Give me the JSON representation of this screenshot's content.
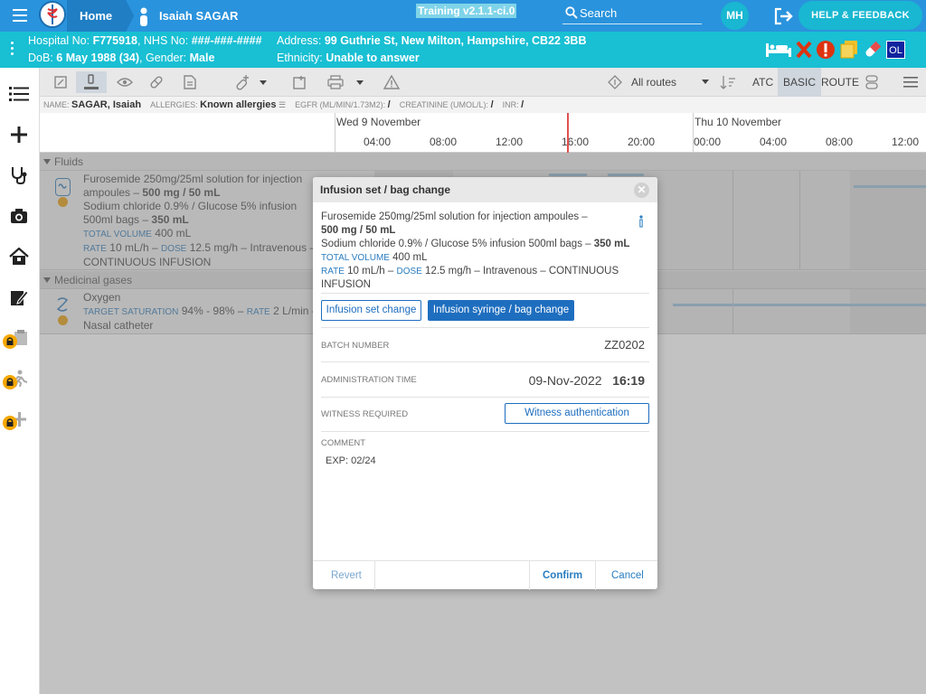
{
  "topbar": {
    "home_label": "Home",
    "patient_name": "Isaiah SAGAR",
    "training_badge": "Training v2.1.1-ci.0",
    "search_placeholder": "Search",
    "avatar_initials": "MH",
    "help_label": "HELP & FEEDBACK"
  },
  "banner": {
    "hospital_label": "Hospital No:",
    "hospital_no": "F775918",
    "nhs_label": "NHS No:",
    "nhs_no": "###-###-####",
    "dob_label": "DoB:",
    "dob": "6 May 1988 (34)",
    "gender_label": "Gender:",
    "gender": "Male",
    "address_label": "Address:",
    "address": "99 Guthrie St, New Milton, Hampshire, CB22 3BB",
    "ethnicity_label": "Ethnicity:",
    "ethnicity": "Unable to answer",
    "ol_badge": "OL"
  },
  "toolbar": {
    "routes_label": "All routes",
    "atc_label": "ATC",
    "basic_label": "BASIC",
    "route_label": "ROUTE"
  },
  "info": {
    "name_label": "NAME:",
    "name": "SAGAR, Isaiah",
    "allergies_label": "ALLERGIES:",
    "allergies": "Known allergies",
    "egfr_label": "EGFR (ML/MIN/1.73M2):",
    "egfr": "/",
    "creatinine_label": "CREATININE (UMOL/L):",
    "creatinine": "/",
    "inr_label": "INR:",
    "inr": "/"
  },
  "timeline": {
    "day1": "Wed 9 November",
    "day2": "Thu 10 November",
    "hours": [
      "04:00",
      "08:00",
      "12:00",
      "16:00",
      "20:00",
      "00:00",
      "04:00",
      "08:00",
      "12:00"
    ]
  },
  "sections": {
    "fluids": "Fluids",
    "gases": "Medicinal gases"
  },
  "fluids_row": {
    "line1": "Furosemide 250mg/25ml solution for injection",
    "line2a": "ampoules – ",
    "line2b": "500 mg / 50 mL",
    "line3": "Sodium chloride 0.9% / Glucose 5% infusion",
    "line4a": "500ml bags – ",
    "line4b": "350 mL",
    "total_label": "TOTAL VOLUME",
    "total_value": "400 mL",
    "rate_label": "RATE",
    "rate_value": "10 mL/h –",
    "dose_label": "DOSE",
    "dose_value": "12.5 mg/h – Intravenous –",
    "line7": "CONTINUOUS INFUSION"
  },
  "gas_row": {
    "name": "Oxygen",
    "sat_label": "TARGET SATURATION",
    "sat_value": "94% - 98% –",
    "rate_label": "RATE",
    "rate_value": "2 L/min –",
    "line3": "Nasal catheter"
  },
  "modal": {
    "title": "Infusion set / bag change",
    "line1": "Furosemide 250mg/25ml solution for injection ampoules –",
    "line2": "500 mg / 50 mL",
    "line3a": "Sodium chloride 0.9% / Glucose 5% infusion 500ml bags – ",
    "line3b": "350 mL",
    "total_label": "TOTAL VOLUME",
    "total_value": "400 mL",
    "rate_label": "RATE",
    "rate_value": "10 mL/h –",
    "dose_label": "DOSE",
    "dose_value": "12.5 mg/h – Intravenous – CONTINUOUS",
    "line6": "INFUSION",
    "btn_set_change": "Infusion set change",
    "btn_syringe_change": "Infusion syringe / bag change",
    "batch_label": "BATCH NUMBER",
    "batch_value": "ZZ0202",
    "admin_label": "ADMINISTRATION TIME",
    "admin_date": "09-Nov-2022",
    "admin_time": "16:19",
    "witness_label": "WITNESS REQUIRED",
    "witness_btn": "Witness authentication",
    "comment_label": "COMMENT",
    "comment_value": "EXP: 02/24",
    "revert": "Revert",
    "confirm": "Confirm",
    "cancel": "Cancel"
  },
  "colors": {
    "topbar": "#2a93dd",
    "banner": "#19bfd3",
    "primary_button": "#1e6ebf",
    "now_line": "#e05050"
  }
}
